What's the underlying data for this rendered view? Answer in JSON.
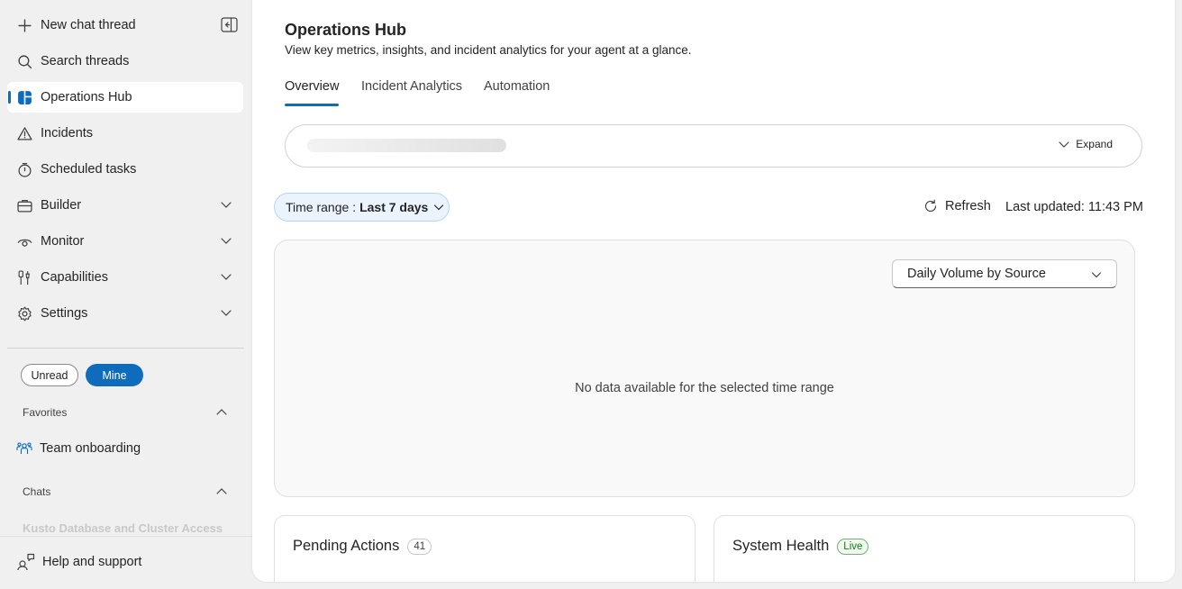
{
  "sidebar": {
    "new_chat": "New chat thread",
    "search": "Search threads",
    "items": [
      {
        "label": "Operations Hub"
      },
      {
        "label": "Incidents"
      },
      {
        "label": "Scheduled tasks"
      },
      {
        "label": "Builder"
      },
      {
        "label": "Monitor"
      },
      {
        "label": "Capabilities"
      },
      {
        "label": "Settings"
      }
    ],
    "filters": {
      "unread": "Unread",
      "mine": "Mine"
    },
    "favorites_label": "Favorites",
    "favorites": [
      {
        "label": "Team onboarding"
      }
    ],
    "chats_label": "Chats",
    "chats": [
      {
        "label": "Kusto Database and Cluster Access"
      }
    ],
    "help": "Help and support"
  },
  "main": {
    "title": "Operations Hub",
    "subtitle": "View key metrics, insights, and incident analytics for your agent at a glance.",
    "tabs": [
      {
        "label": "Overview",
        "active": true
      },
      {
        "label": "Incident Analytics"
      },
      {
        "label": "Automation"
      }
    ],
    "summary": {
      "expand_label": "Expand"
    },
    "time_range": {
      "prefix": "Time range :",
      "value": "Last 7 days"
    },
    "refresh_label": "Refresh",
    "last_updated": "Last updated: 11:43 PM",
    "chart": {
      "selector_value": "Daily Volume by Source",
      "empty_message": "No data available for the selected time range"
    },
    "cards": [
      {
        "title": "Pending Actions",
        "badge": "41"
      },
      {
        "title": "System Health",
        "badge": "Live"
      }
    ]
  },
  "colors": {
    "accent": "#0f6cbd",
    "live": "#107c10"
  }
}
